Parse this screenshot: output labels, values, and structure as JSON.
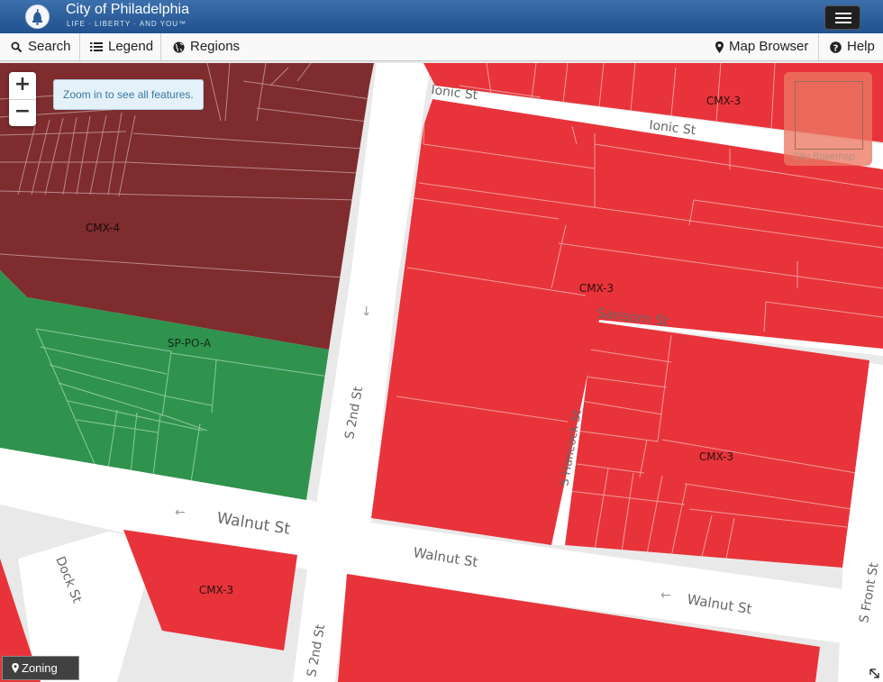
{
  "header": {
    "title": "City of Philadelphia",
    "tagline": "LIFE · LIBERTY · AND YOU™",
    "logo_icon": "liberty-bell-icon",
    "menu_icon": "hamburger-menu-icon"
  },
  "toolbar": {
    "search": {
      "label": "Search",
      "icon": "search-icon"
    },
    "legend": {
      "label": "Legend",
      "icon": "list-icon"
    },
    "regions": {
      "label": "Regions",
      "icon": "globe-icon"
    },
    "map_browser": {
      "label": "Map Browser",
      "icon": "map-marker-icon"
    },
    "help": {
      "label": "Help",
      "icon": "question-icon"
    }
  },
  "map": {
    "zoom_in": "+",
    "zoom_out": "−",
    "zoom_message": "Zoom in to see all features.",
    "basemap_label": "City Basemap",
    "colors": {
      "cmx3": "#e8333a",
      "cmx4": "#7f2c2f",
      "sppoa": "#2f934d",
      "street": "#ffffff",
      "curb": "#dcdcdc",
      "background": "#e9e9e9"
    },
    "zone_labels": {
      "cmx4": "CMX-4",
      "sppoa": "SP-PO-A",
      "cmx3_north": "CMX-3",
      "cmx3_center": "CMX-3",
      "cmx3_southeast": "CMX-3",
      "cmx3_southwest": "CMX-3"
    },
    "street_labels": {
      "ionic_west": "Ionic St",
      "ionic_east": "Ionic St",
      "sansom": "Sansom St",
      "s2nd_north": "S 2nd St",
      "s2nd_south": "S 2nd St",
      "hancock": "S Hancock St",
      "walnut_west": "Walnut St",
      "walnut_center": "Walnut St",
      "walnut_east": "Walnut St",
      "dock": "Dock St",
      "front": "S Front St"
    },
    "oneway_arrow": "←"
  },
  "layer_button": {
    "label": "Zoning",
    "icon": "map-marker-icon"
  },
  "resize_icon": "resize-corner-icon"
}
